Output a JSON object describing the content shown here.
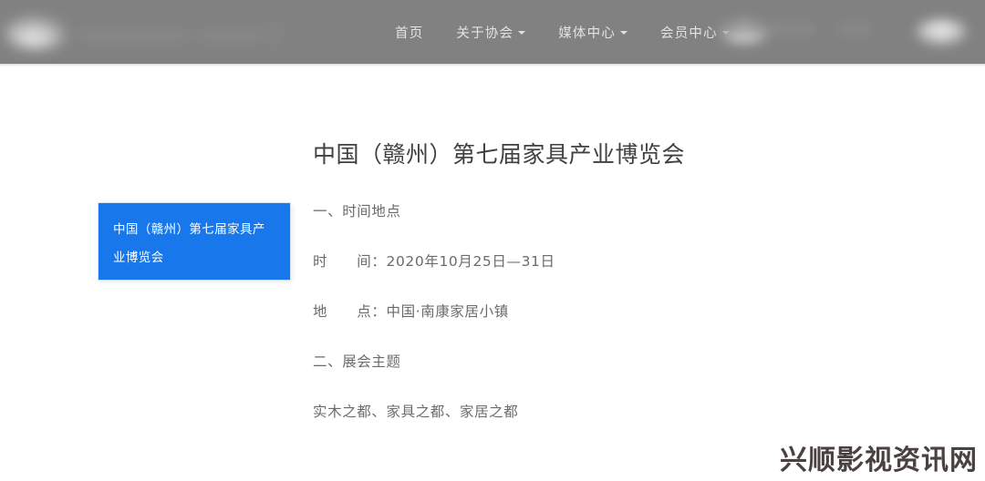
{
  "header": {
    "background_color": "#818181",
    "logo": {
      "name": "site-logo",
      "state": "blurred"
    },
    "nav": [
      {
        "label": "首页",
        "has_dropdown": false
      },
      {
        "label": "关于协会",
        "has_dropdown": true
      },
      {
        "label": "媒体中心",
        "has_dropdown": true
      },
      {
        "label": "会员中心",
        "has_dropdown": true
      }
    ],
    "right_items": [
      {
        "name": "header-blurred-item-1",
        "state": "blurred"
      },
      {
        "name": "header-blurred-item-2",
        "state": "blurred"
      },
      {
        "name": "header-blurred-item-3",
        "state": "blurred"
      }
    ]
  },
  "side_card": {
    "title": "中国（赣州）第七届家具产业博览会",
    "background_color": "#1877ea",
    "text_color": "#ffffff"
  },
  "article": {
    "title": "中国（赣州）第七届家具产业博览会",
    "lines": [
      "一、时间地点",
      "时　　间：2020年10月25日—31日",
      "地　　点：中国·南康家居小镇",
      "二、展会主题",
      "实木之都、家具之都、家居之都"
    ]
  },
  "watermark": {
    "text": "兴顺影视资讯网",
    "color": "#4a4240"
  }
}
